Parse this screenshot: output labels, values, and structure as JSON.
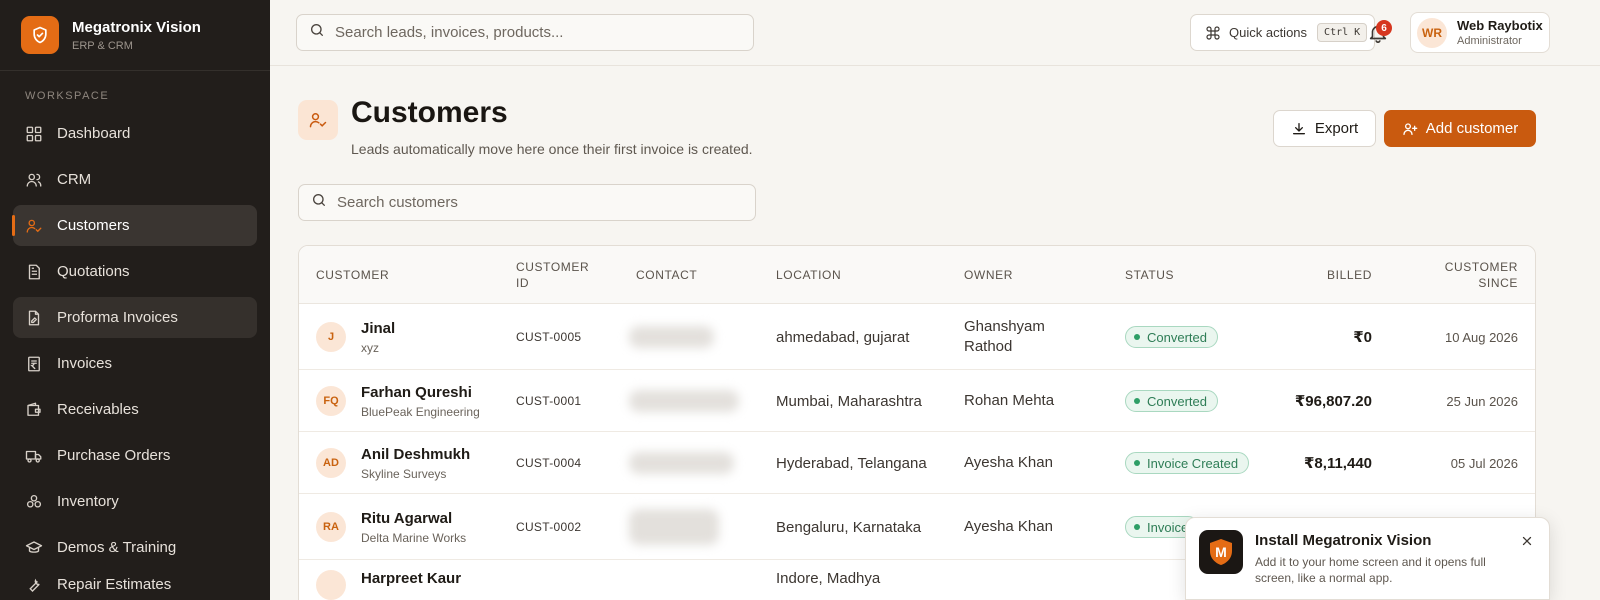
{
  "brand": {
    "name": "Megatronix Vision",
    "subtitle": "ERP & CRM",
    "accent": "#e46c15"
  },
  "sidebar": {
    "section_label": "WORKSPACE",
    "items": [
      {
        "label": "Dashboard",
        "icon": "dashboard-icon",
        "state": "normal"
      },
      {
        "label": "CRM",
        "icon": "users-icon",
        "state": "normal"
      },
      {
        "label": "Customers",
        "icon": "user-check-icon",
        "state": "active"
      },
      {
        "label": "Quotations",
        "icon": "document-icon",
        "state": "normal"
      },
      {
        "label": "Proforma Invoices",
        "icon": "document-edit-icon",
        "state": "hover"
      },
      {
        "label": "Invoices",
        "icon": "rupee-receipt-icon",
        "state": "normal"
      },
      {
        "label": "Receivables",
        "icon": "wallet-icon",
        "state": "normal"
      },
      {
        "label": "Purchase Orders",
        "icon": "truck-icon",
        "state": "normal"
      },
      {
        "label": "Inventory",
        "icon": "boxes-icon",
        "state": "normal"
      },
      {
        "label": "Demos & Training",
        "icon": "graduation-cap-icon",
        "state": "normal"
      },
      {
        "label": "Repair Estimates",
        "icon": "wrench-icon",
        "state": "normal"
      }
    ]
  },
  "topbar": {
    "search_placeholder": "Search leads, invoices, products...",
    "quick_actions_label": "Quick actions",
    "quick_actions_shortcut": "Ctrl K",
    "notification_count": "6",
    "user": {
      "initials": "WR",
      "name": "Web Raybotix",
      "role": "Administrator"
    }
  },
  "page": {
    "title": "Customers",
    "subtitle": "Leads automatically move here once their first invoice is created.",
    "export_label": "Export",
    "add_label": "Add customer",
    "search_placeholder": "Search customers"
  },
  "table": {
    "headers": {
      "customer": "CUSTOMER",
      "customer_id_1": "CUSTOMER",
      "customer_id_2": "ID",
      "contact": "CONTACT",
      "location": "LOCATION",
      "owner": "OWNER",
      "status": "STATUS",
      "billed": "BILLED",
      "since_1": "CUSTOMER",
      "since_2": "SINCE"
    },
    "rows": [
      {
        "initials": "J",
        "name": "Jinal",
        "company": "xyz",
        "id": "CUST-0005",
        "location": "ahmedabad, gujarat",
        "owner_1": "Ghanshyam",
        "owner_2": "Rathod",
        "status": "Converted",
        "billed": "₹0",
        "since": "10 Aug 2026"
      },
      {
        "initials": "FQ",
        "name": "Farhan Qureshi",
        "company": "BluePeak Engineering",
        "id": "CUST-0001",
        "location": "Mumbai, Maharashtra",
        "owner_1": "Rohan Mehta",
        "owner_2": "",
        "status": "Converted",
        "billed": "₹96,807.20",
        "since": "25 Jun 2026"
      },
      {
        "initials": "AD",
        "name": "Anil Deshmukh",
        "company": "Skyline Surveys",
        "id": "CUST-0004",
        "location": "Hyderabad, Telangana",
        "owner_1": "Ayesha Khan",
        "owner_2": "",
        "status": "Invoice Created",
        "billed": "₹8,11,440",
        "since": "05 Jul 2026"
      },
      {
        "initials": "RA",
        "name": "Ritu Agarwal",
        "company": "Delta Marine Works",
        "id": "CUST-0002",
        "location": "Bengaluru, Karnataka",
        "owner_1": "Ayesha Khan",
        "owner_2": "",
        "status": "Invoice",
        "billed": "",
        "since": ""
      },
      {
        "initials": "",
        "name": "Harpreet Kaur",
        "company": "",
        "id": "",
        "location": "Indore, Madhya",
        "owner_1": "",
        "owner_2": "",
        "status": "",
        "billed": "",
        "since": ""
      }
    ]
  },
  "install_toast": {
    "title": "Install Megatronix Vision",
    "body": "Add it to your home screen and it opens full screen, like a normal app.",
    "logo_letter": "M"
  }
}
